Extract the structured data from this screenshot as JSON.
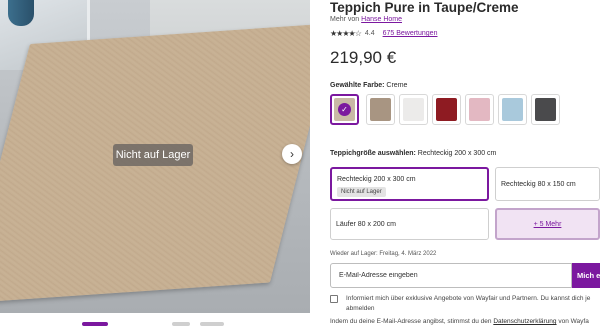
{
  "gallery": {
    "badge": "Nicht auf Lager",
    "next_icon": "›"
  },
  "product": {
    "title": "Teppich Pure in Taupe/Creme",
    "brand_prefix": "Mehr von",
    "brand": "Hanse Home",
    "stars": "★★★★☆",
    "rating": "4.4",
    "reviews": "675 Bewertungen",
    "price": "219,90 €"
  },
  "color": {
    "label": "Gewählte Farbe:",
    "value": "Creme",
    "swatches": [
      {
        "name": "creme",
        "color": "#c9b9a6",
        "selected": true
      },
      {
        "name": "taupe",
        "color": "#a89582",
        "selected": false
      },
      {
        "name": "weiss",
        "color": "#ecebea",
        "selected": false
      },
      {
        "name": "rot",
        "color": "#8e1b22",
        "selected": false
      },
      {
        "name": "rosa",
        "color": "#e3b8c2",
        "selected": false
      },
      {
        "name": "hellblau",
        "color": "#a9c9dc",
        "selected": false
      },
      {
        "name": "anthrazit",
        "color": "#4a4a4c",
        "selected": false
      }
    ]
  },
  "size": {
    "label": "Teppichgröße auswählen:",
    "value": "Rechteckig 200 x 300 cm",
    "options": [
      {
        "label": "Rechteckig 200 x 300 cm",
        "badge": "Nicht auf Lager"
      },
      {
        "label": "Rechteckig 80 x 150 cm"
      },
      {
        "label": "Läufer 80 x 200 cm"
      },
      {
        "label": "+ 5 Mehr"
      }
    ]
  },
  "restock": "Wieder auf Lager: Freitag, 4. März 2022",
  "notify": {
    "placeholder": "E-Mail-Adresse eingeben",
    "button": "Mich er"
  },
  "consent": {
    "text": "Informiert mich über exklusive Angebote von Wayfair und Partnern. Du kannst dich je",
    "text2": "abmelden"
  },
  "privacy": {
    "prefix": "Indem du deine E-Mail-Adresse angibst, stimmst du den",
    "link": "Datenschutzerklärung",
    "suffix": "von Wayfa"
  },
  "colors": {
    "accent": "#7b189f"
  }
}
